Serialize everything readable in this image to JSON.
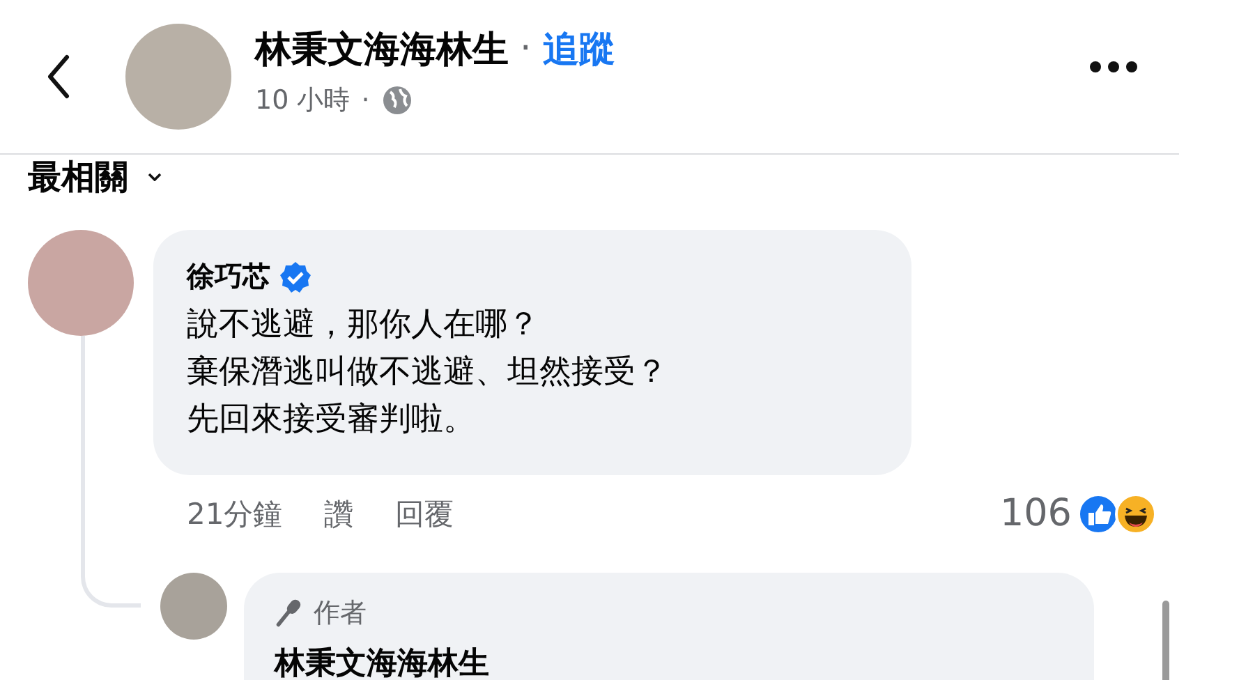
{
  "header": {
    "author": "林秉文海海林生",
    "separator": "·",
    "follow": "追蹤",
    "time": "10 小時",
    "time_separator": "·"
  },
  "sort": {
    "label": "最相關"
  },
  "comment": {
    "author": "徐巧芯",
    "verified": true,
    "lines": [
      "說不逃避，那你人在哪？",
      "棄保潛逃叫做不逃避、坦然接受？",
      "先回來接受審判啦。"
    ],
    "time": "21分鐘",
    "like": "讚",
    "reply": "回覆",
    "reaction_count": "106"
  },
  "reply": {
    "badge": "作者",
    "author": "林秉文海海林生"
  }
}
